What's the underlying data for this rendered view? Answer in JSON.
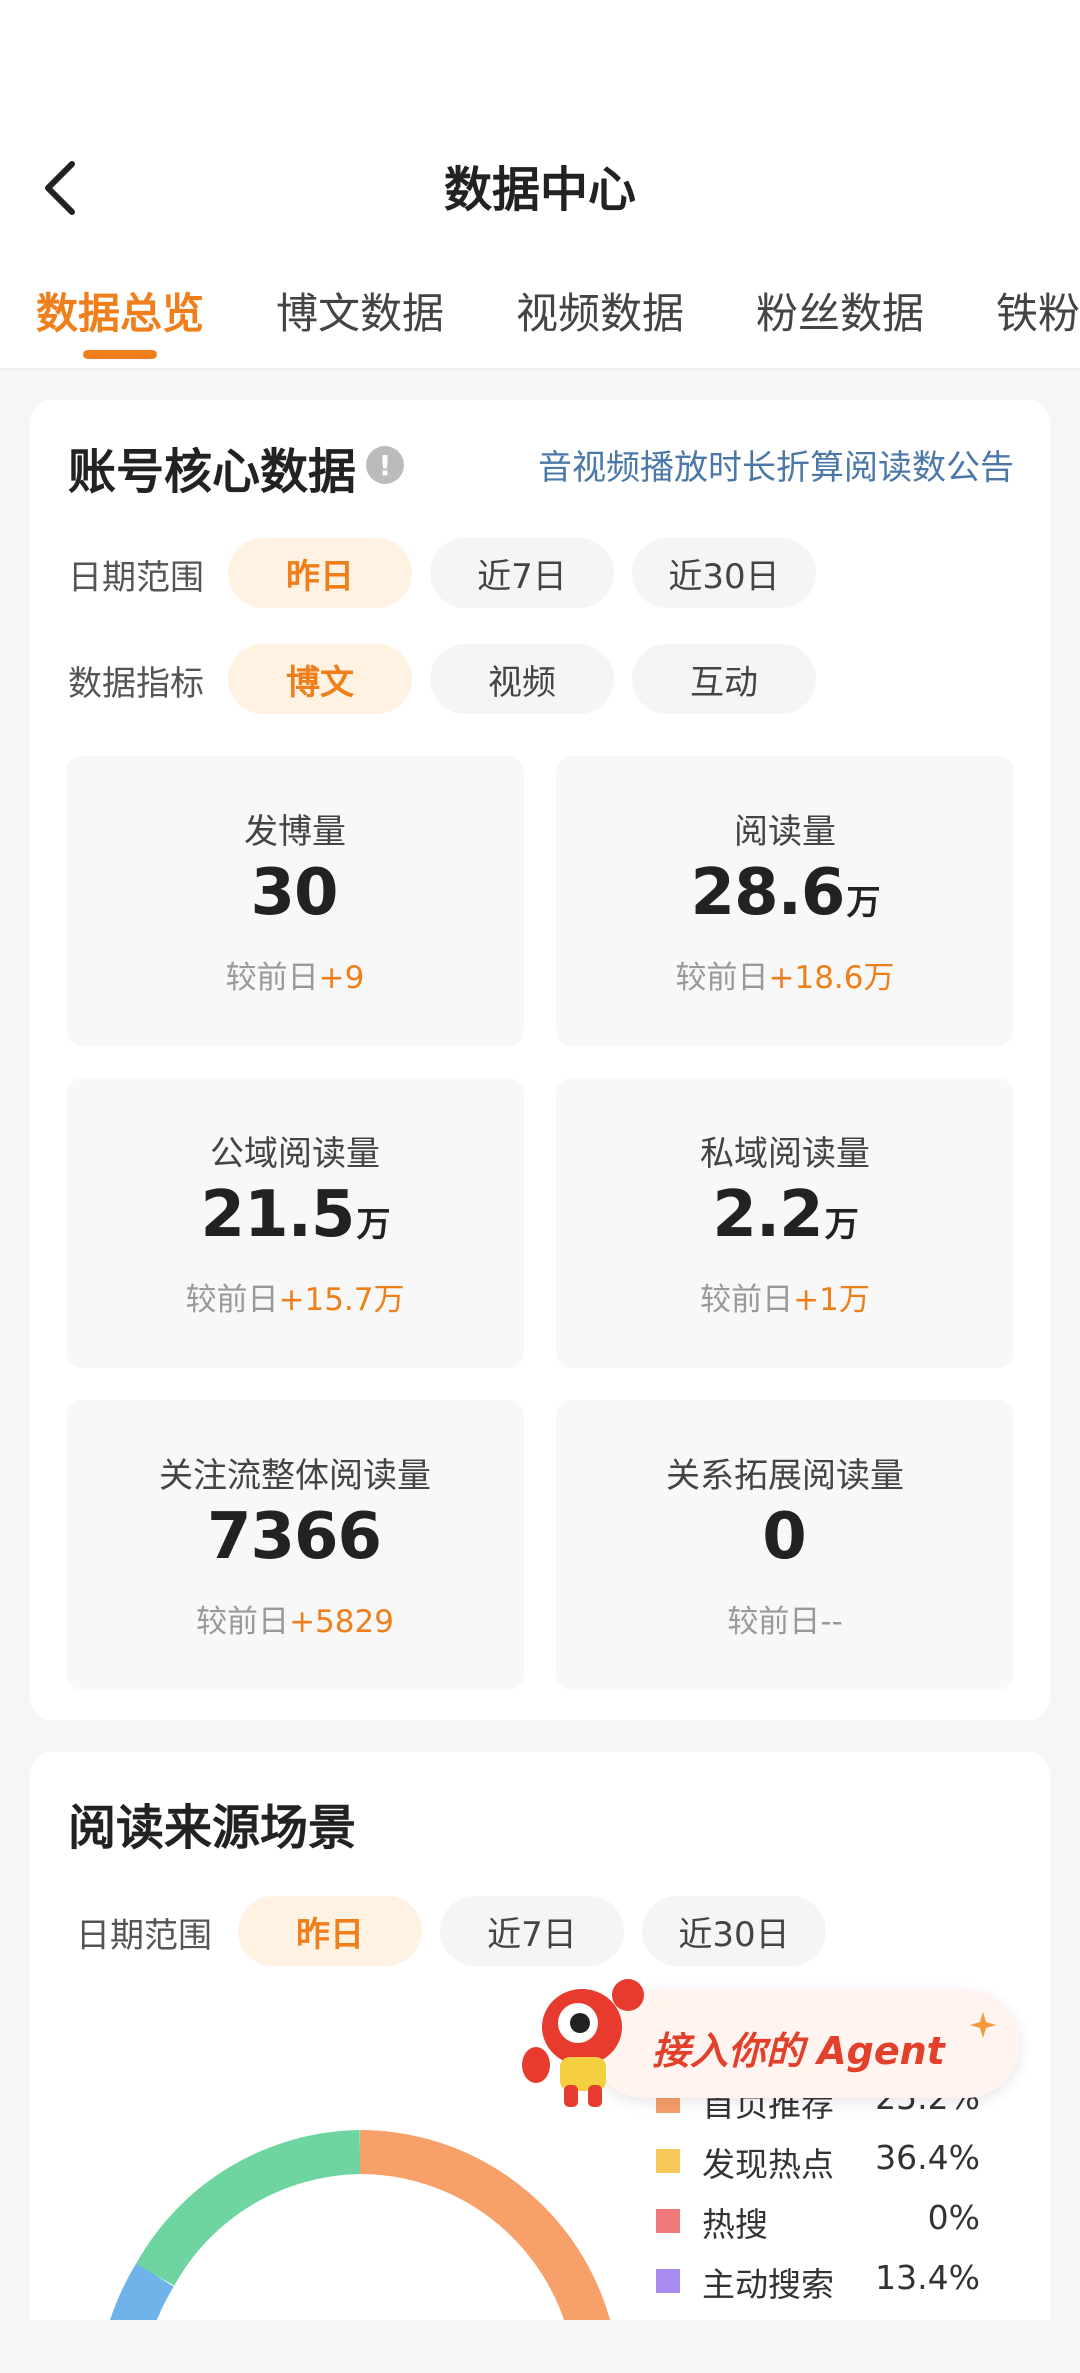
{
  "header": {
    "title": "数据中心",
    "tabs": [
      {
        "label": "数据总览",
        "active": true
      },
      {
        "label": "博文数据",
        "active": false
      },
      {
        "label": "视频数据",
        "active": false
      },
      {
        "label": "粉丝数据",
        "active": false
      },
      {
        "label": "铁粉",
        "active": false
      }
    ]
  },
  "core": {
    "title": "账号核心数据",
    "info_icon": "!",
    "notice": "音视频播放时长折算阅读数公告",
    "date_label": "日期范围",
    "date_options": [
      "昨日",
      "近7日",
      "近30日"
    ],
    "date_selected": "昨日",
    "metric_label": "数据指标",
    "metric_options": [
      "博文",
      "视频",
      "互动"
    ],
    "metric_selected": "博文",
    "compare_prefix": "较前日",
    "stats": [
      {
        "label": "发博量",
        "value": "30",
        "unit": "",
        "delta": "+9"
      },
      {
        "label": "阅读量",
        "value": "28.6",
        "unit": "万",
        "delta": "+18.6万"
      },
      {
        "label": "公域阅读量",
        "value": "21.5",
        "unit": "万",
        "delta": "+15.7万"
      },
      {
        "label": "私域阅读量",
        "value": "2.2",
        "unit": "万",
        "delta": "+1万"
      },
      {
        "label": "关注流整体阅读量",
        "value": "7366",
        "unit": "",
        "delta": "+5829"
      },
      {
        "label": "关系拓展阅读量",
        "value": "0",
        "unit": "",
        "delta": "--"
      }
    ]
  },
  "source": {
    "title": "阅读来源场景",
    "date_label": "日期范围",
    "date_options": [
      "昨日",
      "近7日",
      "近30日"
    ],
    "date_selected": "昨日",
    "legend": [
      {
        "name": "首页推荐",
        "value": "25.2%",
        "color": "#f7a06a"
      },
      {
        "name": "发现热点",
        "value": "36.4%",
        "color": "#f9c85a"
      },
      {
        "name": "热搜",
        "value": "0%",
        "color": "#f07a7a"
      },
      {
        "name": "主动搜索",
        "value": "13.4%",
        "color": "#a78bf0"
      }
    ]
  },
  "agent_banner": {
    "text": "接入你的 Agent"
  },
  "colors": {
    "accent": "#ee7f1b",
    "link": "#4c78a8"
  }
}
